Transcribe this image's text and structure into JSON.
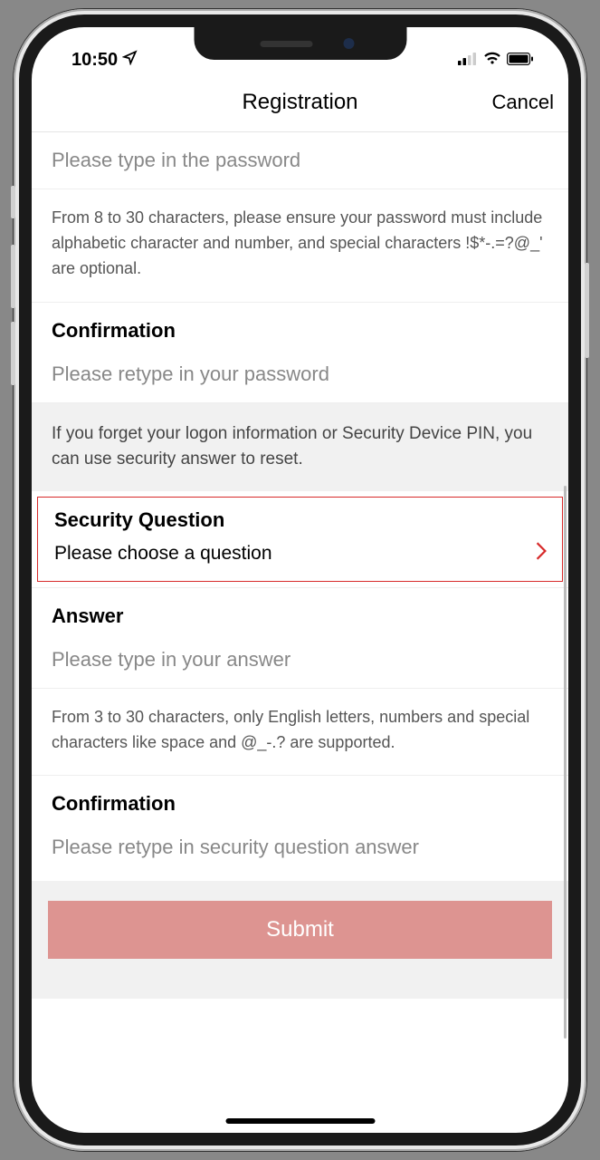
{
  "status": {
    "time": "10:50"
  },
  "nav": {
    "title": "Registration",
    "cancel": "Cancel"
  },
  "password": {
    "placeholder": "Please type in the password",
    "helper": "From 8 to 30 characters, please ensure your password must include alphabetic character and number, and special characters !$*-.=?@_' are optional."
  },
  "password_confirm": {
    "label": "Confirmation",
    "placeholder": "Please retype in your password"
  },
  "security_info": "If you forget your logon information or Security Device PIN, you can use security answer to reset.",
  "security_question": {
    "label": "Security Question",
    "placeholder": "Please choose a question"
  },
  "answer": {
    "label": "Answer",
    "placeholder": "Please type in your answer",
    "helper": "From 3 to 30 characters, only English letters, numbers and special characters like space and @_-.? are supported."
  },
  "answer_confirm": {
    "label": "Confirmation",
    "placeholder": "Please retype in security question answer"
  },
  "submit": {
    "label": "Submit"
  }
}
